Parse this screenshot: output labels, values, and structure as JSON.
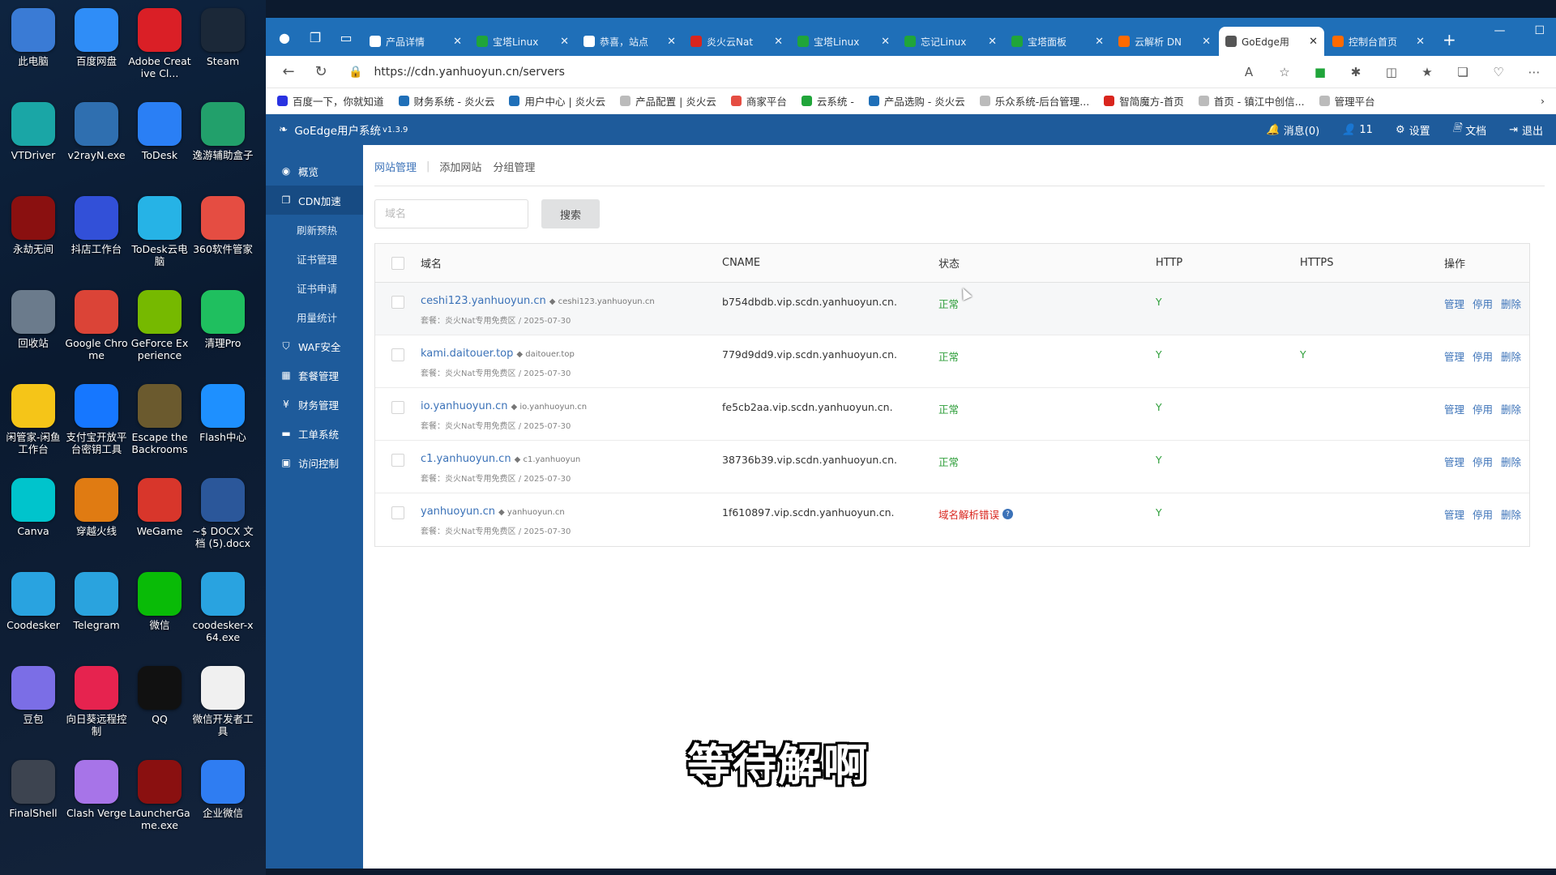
{
  "desktop": {
    "icons": [
      {
        "label": "此电脑",
        "color": "#3a7bd5"
      },
      {
        "label": "百度网盘",
        "color": "#2f8df7"
      },
      {
        "label": "Adobe Creative Cl...",
        "color": "#da1f26"
      },
      {
        "label": "Steam",
        "color": "#1b2838"
      },
      {
        "label": "VTDriver",
        "color": "#1aa6a6"
      },
      {
        "label": "v2rayN.exe",
        "color": "#2f6fb0"
      },
      {
        "label": "ToDesk",
        "color": "#2a7ff5"
      },
      {
        "label": "逸游辅助盒子",
        "color": "#22a06b"
      },
      {
        "label": "永劫无间",
        "color": "#8a1010"
      },
      {
        "label": "抖店工作台",
        "color": "#3250d8"
      },
      {
        "label": "ToDesk云电脑",
        "color": "#26b3e6"
      },
      {
        "label": "360软件管家",
        "color": "#e54d42"
      },
      {
        "label": "回收站",
        "color": "#6b7b8c"
      },
      {
        "label": "Google Chrome",
        "color": "#db4437"
      },
      {
        "label": "GeForce Experience",
        "color": "#76b900"
      },
      {
        "label": "清理Pro",
        "color": "#1fbf5f"
      },
      {
        "label": "闲管家-闲鱼工作台",
        "color": "#f5c518"
      },
      {
        "label": "支付宝开放平台密钥工具",
        "color": "#1677ff"
      },
      {
        "label": "Escape the Backrooms",
        "color": "#6b5a2e"
      },
      {
        "label": "Flash中心",
        "color": "#1e90ff"
      },
      {
        "label": "Canva",
        "color": "#00c4cc"
      },
      {
        "label": "穿越火线",
        "color": "#e07b12"
      },
      {
        "label": "WeGame",
        "color": "#d8362b"
      },
      {
        "label": "~$ DOCX 文档 (5).docx",
        "color": "#2b579a"
      },
      {
        "label": "Coodesker",
        "color": "#29a3e0"
      },
      {
        "label": "Telegram",
        "color": "#2aa3de"
      },
      {
        "label": "微信",
        "color": "#09bb07"
      },
      {
        "label": "coodesker-x64.exe",
        "color": "#29a3e0"
      },
      {
        "label": "豆包",
        "color": "#7b6ee6"
      },
      {
        "label": "向日葵远程控制",
        "color": "#e6234f"
      },
      {
        "label": "QQ",
        "color": "#111111"
      },
      {
        "label": "微信开发者工具",
        "color": "#f0f0f0"
      },
      {
        "label": "FinalShell",
        "color": "#3d4450"
      },
      {
        "label": "Clash Verge",
        "color": "#a774e8"
      },
      {
        "label": "LauncherGame.exe",
        "color": "#8a1010"
      },
      {
        "label": "企业微信",
        "color": "#2f7df2"
      }
    ]
  },
  "browser": {
    "tabs": [
      {
        "title": "产品详情",
        "color": "#ffffff"
      },
      {
        "title": "宝塔Linux",
        "color": "#20a53a"
      },
      {
        "title": "恭喜，站点",
        "color": "#ffffff"
      },
      {
        "title": "炎火云Nat",
        "color": "#d9251d"
      },
      {
        "title": "宝塔Linux",
        "color": "#20a53a"
      },
      {
        "title": "忘记Linux",
        "color": "#20a53a"
      },
      {
        "title": "宝塔面板",
        "color": "#20a53a"
      },
      {
        "title": "云解析 DN",
        "color": "#ff6a00"
      },
      {
        "title": "GoEdge用",
        "color": "#555555",
        "active": true
      },
      {
        "title": "控制台首页",
        "color": "#ff6a00"
      }
    ],
    "url": "https://cdn.yanhuoyun.cn/servers",
    "bookmarks": [
      {
        "label": "百度一下，你就知道",
        "color": "#2932e1"
      },
      {
        "label": "财务系统 - 炎火云",
        "color": "#1f6fb8"
      },
      {
        "label": "用户中心 | 炎火云",
        "color": "#1f6fb8"
      },
      {
        "label": "产品配置 | 炎火云",
        "color": "#bbbbbb"
      },
      {
        "label": "商家平台",
        "color": "#e54d42"
      },
      {
        "label": "云系统 -",
        "color": "#20a53a"
      },
      {
        "label": "产品选购 - 炎火云",
        "color": "#1f6fb8"
      },
      {
        "label": "乐众系统-后台管理...",
        "color": "#bbbbbb"
      },
      {
        "label": "智简魔方-首页",
        "color": "#d9251d"
      },
      {
        "label": "首页 - 镇江中创信...",
        "color": "#bbbbbb"
      },
      {
        "label": "管理平台",
        "color": "#bbbbbb"
      }
    ]
  },
  "app": {
    "brand": "GoEdge用户系统",
    "version": "v1.3.9",
    "header": {
      "messages": "消息(0)",
      "user": "11",
      "settings": "设置",
      "docs": "文档",
      "logout": "退出"
    },
    "sidebar": {
      "overview": "概览",
      "cdn": "CDN加速",
      "cdn_sub": [
        "刷新预热",
        "证书管理",
        "证书申请",
        "用量统计"
      ],
      "waf": "WAF安全",
      "package": "套餐管理",
      "finance": "财务管理",
      "ticket": "工单系统",
      "access": "访问控制"
    },
    "subnav": {
      "manage": "网站管理",
      "add": "添加网站",
      "group": "分组管理"
    },
    "search": {
      "placeholder": "域名",
      "button": "搜索"
    },
    "table": {
      "headers": {
        "domain": "域名",
        "cname": "CNAME",
        "status": "状态",
        "http": "HTTP",
        "https": "HTTPS",
        "ops": "操作"
      },
      "rows": [
        {
          "domain": "ceshi123.yanhuoyun.cn",
          "tag": "ceshi123.yanhuoyun.cn",
          "meta": "套餐：炎火Nat专用免费区 / 2025-07-30",
          "cname": "b754dbdb.vip.scdn.yanhuoyun.cn.",
          "status": "正常",
          "status_ok": true,
          "http": "Y",
          "https": ""
        },
        {
          "domain": "kami.daitouer.top",
          "tag": "daitouer.top",
          "meta": "套餐：炎火Nat专用免费区 / 2025-07-30",
          "cname": "779d9dd9.vip.scdn.yanhuoyun.cn.",
          "status": "正常",
          "status_ok": true,
          "http": "Y",
          "https": "Y"
        },
        {
          "domain": "io.yanhuoyun.cn",
          "tag": "io.yanhuoyun.cn",
          "meta": "套餐：炎火Nat专用免费区 / 2025-07-30",
          "cname": "fe5cb2aa.vip.scdn.yanhuoyun.cn.",
          "status": "正常",
          "status_ok": true,
          "http": "Y",
          "https": ""
        },
        {
          "domain": "c1.yanhuoyun.cn",
          "tag": "c1.yanhuoyun",
          "meta": "套餐：炎火Nat专用免费区 / 2025-07-30",
          "cname": "38736b39.vip.scdn.yanhuoyun.cn.",
          "status": "正常",
          "status_ok": true,
          "http": "Y",
          "https": ""
        },
        {
          "domain": "yanhuoyun.cn",
          "tag": "yanhuoyun.cn",
          "meta": "套餐：炎火Nat专用免费区 / 2025-07-30",
          "cname": "1f610897.vip.scdn.yanhuoyun.cn.",
          "status": "域名解析错误",
          "status_ok": false,
          "http": "Y",
          "https": ""
        }
      ],
      "ops": {
        "manage": "管理",
        "disable": "停用",
        "delete": "删除"
      }
    }
  },
  "subtitle": "等待解啊"
}
